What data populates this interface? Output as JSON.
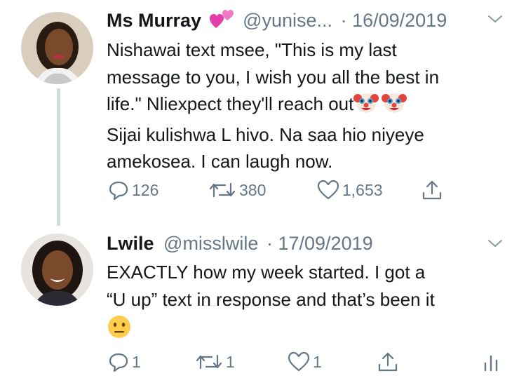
{
  "tweets": [
    {
      "name": "Ms Murray",
      "handle": "@yunise...",
      "separator": "·",
      "date": "16/09/2019",
      "text_lines": [
        "Nishawai text msee, \"This is my last",
        "message to you, I wish you all the best in",
        "life.\" Nliexpect they'll reach out",
        "Sijai kulishwa L hivo. Na saa hio niyeye",
        "amekosea. I can  laugh now."
      ],
      "replies": "126",
      "retweets": "380",
      "likes": "1,653"
    },
    {
      "name": "Lwile",
      "handle": "@misslwile",
      "separator": "·",
      "date": "17/09/2019",
      "text_lines": [
        "EXACTLY how my week started. I got a",
        "“U up” text in response and that’s been it"
      ],
      "replies": "1",
      "retweets": "1",
      "likes": "1"
    }
  ],
  "icons": {
    "name_emoji": "two-hearts-icon",
    "inline_emoji": "clown-face-icon",
    "reaction_emoji": "neutral-face-icon",
    "reply": "reply-icon",
    "retweet": "retweet-icon",
    "like": "heart-icon",
    "share": "share-icon",
    "analytics": "analytics-icon",
    "menu": "chevron-down-icon"
  },
  "colors": {
    "text": "#14171a",
    "secondary": "#657786",
    "thread_line": "#cfd9de"
  }
}
